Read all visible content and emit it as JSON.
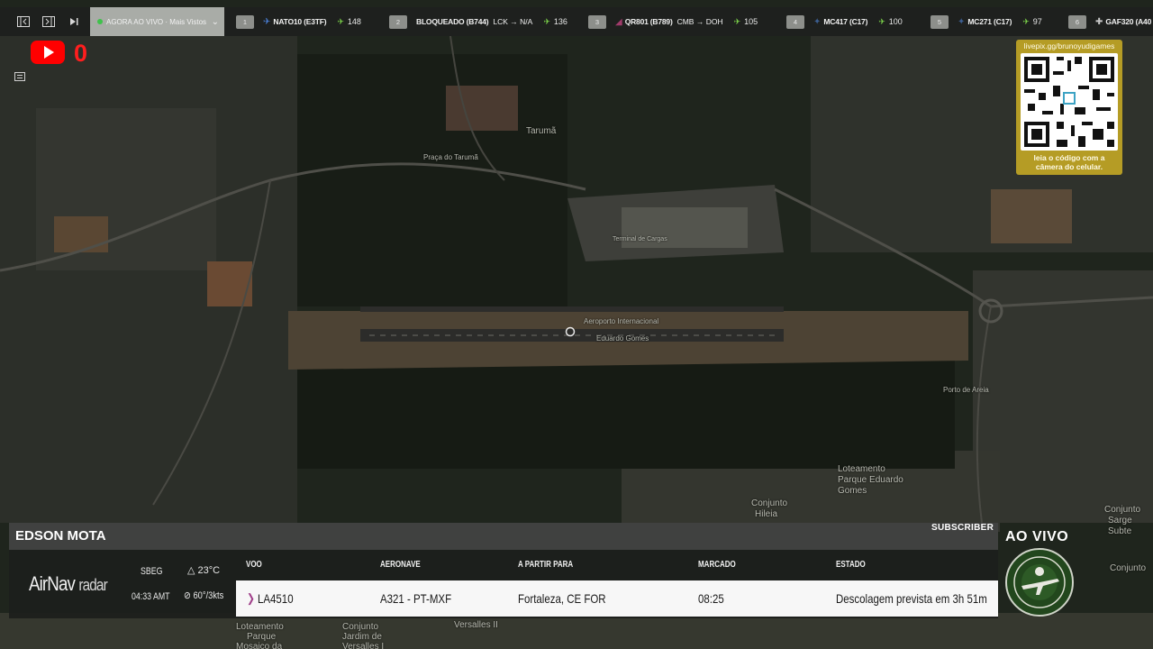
{
  "map": {
    "labels": {
      "taruma": "Tarumã",
      "praca_taruma": "Praça do Tarumã",
      "terminal": "Terminal de Cargas",
      "aeroporto_1": "Aeroporto Internacional",
      "aeroporto_2": "Eduardo Gomes",
      "porto": "Porto de Areia",
      "loteamento_parque_1": "Loteamento",
      "loteamento_parque_2": "Parque Eduardo",
      "loteamento_parque_3": "Gomes",
      "conjunto_hileia_1": "Conjunto",
      "conjunto_hileia_2": "Hileia",
      "conjunto_jardim_1": "Conjunto",
      "conjunto_jardim_2": "Jardim de",
      "conjunto_jardim_3": "Versalles I",
      "versalles_ii": "Versalles II",
      "loteamento_mosaico_1": "Loteamento",
      "loteamento_mosaico_2": "Parque",
      "loteamento_mosaico_3": "Mosaico da",
      "conjunto_sargento_1": "Conjunto",
      "conjunto_sargento_2": "Sarge",
      "conjunto_sargento_3": "Subte",
      "conj_right": "Conjunto"
    }
  },
  "topbar": {
    "live_label": "AGORA AO VIVO",
    "live_more": "· Mais Vistos",
    "flights": [
      {
        "num": "1",
        "callsign": "NATO10 (E3TF)",
        "route": "",
        "alt": "148"
      },
      {
        "num": "2",
        "callsign": "BLOQUEADO (B744)",
        "route": "LCK → N/A",
        "alt": "136"
      },
      {
        "num": "3",
        "callsign": "QR801 (B789)",
        "route": "CMB → DOH",
        "alt": "105"
      },
      {
        "num": "4",
        "callsign": "MC417 (C17)",
        "route": "",
        "alt": "100"
      },
      {
        "num": "5",
        "callsign": "MC271 (C17)",
        "route": "",
        "alt": "97"
      },
      {
        "num": "6",
        "callsign": "GAF320 (A40",
        "route": "",
        "alt": ""
      }
    ]
  },
  "youtube": {
    "count": "0"
  },
  "qr": {
    "url": "livepix.gg/brunoyudigames",
    "caption_1": "leia o código com a",
    "caption_2": "câmera do celular."
  },
  "panel": {
    "name": "EDSON MOTA",
    "subscriber": "SUBSCRIBER",
    "brand_main": "AirNav",
    "brand_sub": "radar",
    "icao": "SBEG",
    "time": "04:33 AMT",
    "temp": "23°C",
    "wind": "60°/3kts",
    "headers": {
      "voo": "VOO",
      "aeronave": "AERONAVE",
      "destino": "A PARTIR PARA",
      "marcado": "MARCADO",
      "estado": "ESTADO"
    },
    "row": {
      "voo": "LA4510",
      "aeronave": "A321 - PT-MXF",
      "destino": "Fortaleza, CE FOR",
      "marcado": "08:25",
      "estado": "Descolagem prevista em 3h 51m"
    }
  },
  "badge": {
    "live": "AO VIVO"
  },
  "colors": {
    "alt_green": "#7cd44a",
    "youtube_red": "#ff0000",
    "qr_gold": "#b59c25"
  }
}
